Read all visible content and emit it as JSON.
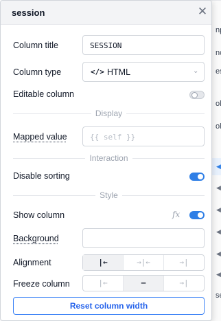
{
  "panel": {
    "title": "session"
  },
  "fields": {
    "column_title": {
      "label": "Column title",
      "value": "SESSION"
    },
    "column_type": {
      "label": "Column type",
      "icon": "</>",
      "value": "HTML"
    },
    "editable": {
      "label": "Editable column",
      "on": false
    }
  },
  "sections": {
    "display": "Display",
    "interaction": "Interaction",
    "style": "Style"
  },
  "display": {
    "mapped_value": {
      "label": "Mapped value",
      "placeholder": "{{ self }}"
    }
  },
  "interaction": {
    "disable_sorting": {
      "label": "Disable sorting",
      "on": true
    }
  },
  "style": {
    "show_column": {
      "label": "Show column",
      "fx": "fx",
      "on": true
    },
    "background": {
      "label": "Background"
    },
    "alignment": {
      "label": "Alignment",
      "options": [
        "|←",
        "→|←",
        "→|"
      ],
      "selected": 0
    },
    "freeze": {
      "label": "Freeze column",
      "options": [
        "|←",
        "—",
        "→|"
      ],
      "selected": 1
    }
  },
  "reset_button": {
    "label": "Reset column width"
  },
  "background_app": {
    "fragments": [
      "np",
      "nc",
      "es",
      "ol",
      "ol",
      "se"
    ]
  },
  "colors": {
    "accent": "#2f7fe6",
    "button_text": "#2563eb"
  }
}
